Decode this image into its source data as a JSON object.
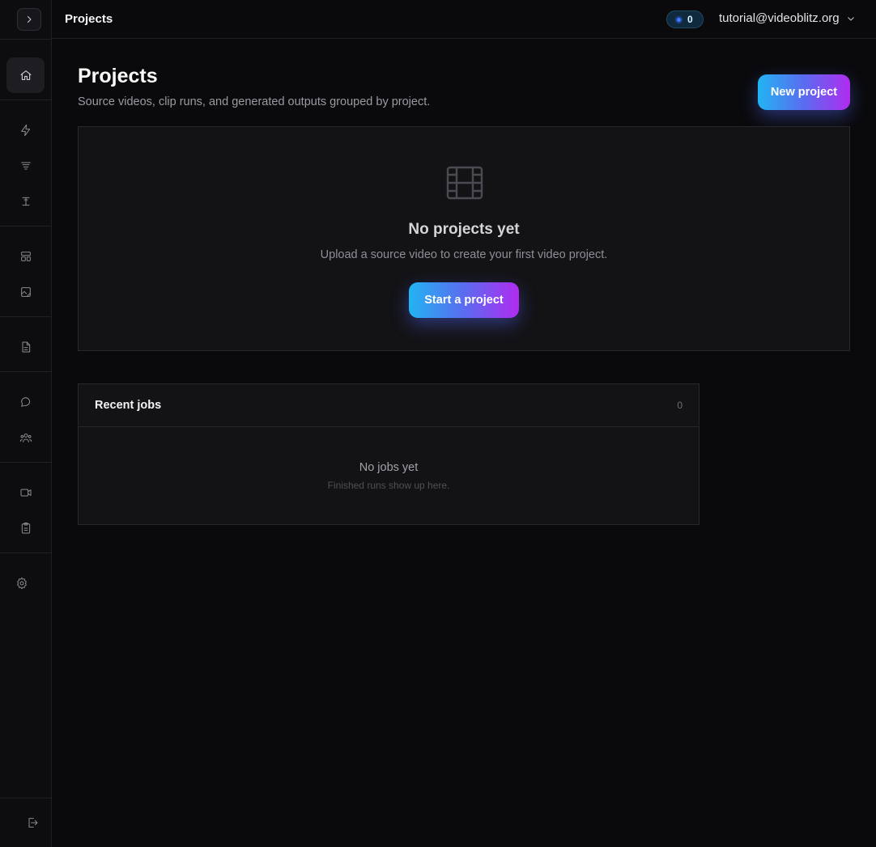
{
  "topbar": {
    "title": "Projects",
    "credits": "0",
    "account_email": "tutorial@videoblitz.org"
  },
  "page": {
    "title": "Projects",
    "subtitle": "Source videos, clip runs, and generated outputs grouped by project.",
    "new_project_label": "New project"
  },
  "empty_state": {
    "icon": "film-icon",
    "title": "No projects yet",
    "description": "Upload a source video to create your first video project.",
    "button_label": "Start a project"
  },
  "recent_jobs": {
    "title": "Recent jobs",
    "count": "0",
    "empty_title": "No jobs yet",
    "empty_description": "Finished runs show up here."
  },
  "sidebar": {
    "items": [
      {
        "icon": "home-icon",
        "active": true
      },
      {
        "icon": "lightning-icon"
      },
      {
        "icon": "filter-lines-icon"
      },
      {
        "icon": "text-cursor-icon"
      },
      {
        "icon": "layout-template-icon"
      },
      {
        "icon": "image-edit-icon"
      },
      {
        "icon": "document-icon"
      },
      {
        "icon": "chat-bubble-icon"
      },
      {
        "icon": "users-icon"
      },
      {
        "icon": "video-camera-icon"
      },
      {
        "icon": "clipboard-icon"
      },
      {
        "icon": "settings-gear-icon"
      },
      {
        "icon": "logout-icon"
      }
    ]
  },
  "colors": {
    "background": "#0a0a0c",
    "card": "#131316",
    "accent_start": "#22b4f2",
    "accent_end": "#b02cf0"
  }
}
